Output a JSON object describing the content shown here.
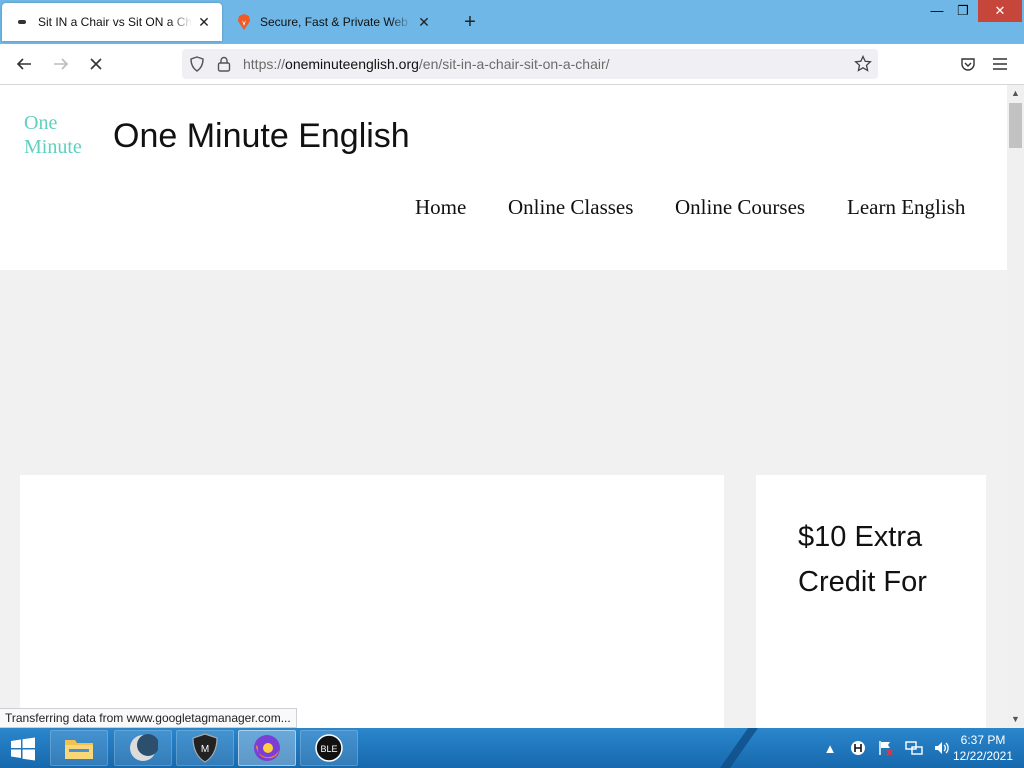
{
  "browser": {
    "tabs": [
      {
        "title": "Sit IN a Chair vs Sit ON a Chair - One Minute English",
        "active": true,
        "icon": "loading-dot-icon"
      },
      {
        "title": "Secure, Fast & Private Web Browser with Adblocker",
        "active": false,
        "icon": "brave-lion-icon"
      }
    ],
    "window_controls": {
      "minimize": "—",
      "maximize": "❐",
      "close": "✕"
    },
    "url": {
      "prefix": "https://",
      "host": "oneminuteenglish.org",
      "path": "/en/sit-in-a-chair-sit-on-a-chair/"
    },
    "status_text": "Transferring data from www.googletagmanager.com..."
  },
  "site": {
    "logo_line1": "One",
    "logo_line2": "Minute",
    "title": "One Minute English",
    "menu": [
      "Home",
      "Online Classes",
      "Online Courses",
      "Learn English"
    ],
    "promo_text": "$10 Extra Credit For"
  },
  "taskbar": {
    "apps": [
      {
        "name": "file-explorer-icon",
        "running": false
      },
      {
        "name": "crescent-app-icon",
        "running": false
      },
      {
        "name": "shield-app-icon",
        "running": false
      },
      {
        "name": "firefox-icon",
        "running": true
      },
      {
        "name": "ble-app-icon",
        "running": false
      }
    ],
    "clock_time": "6:37 PM",
    "clock_date": "12/22/2021"
  },
  "colors": {
    "titlebar": "#6fb7e6",
    "logo": "#5fd0c0",
    "close_button": "#c7463c",
    "taskbar": "#1a6fb3"
  }
}
